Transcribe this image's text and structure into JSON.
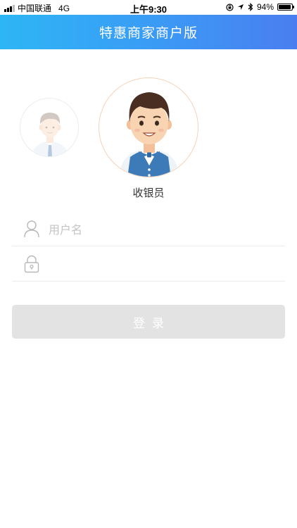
{
  "status_bar": {
    "carrier": "中国联通",
    "network": "4G",
    "time": "上午9:30",
    "battery": "94%",
    "battery_level": 0.94
  },
  "nav": {
    "title": "特惠商家商户版"
  },
  "roles": {
    "selected_label": "收银员",
    "selected_icon": "cashier-avatar-icon",
    "other_icon": "owner-avatar-icon"
  },
  "form": {
    "username": {
      "placeholder": "用户名",
      "value": "",
      "icon": "user-icon"
    },
    "password": {
      "placeholder": "",
      "value": "",
      "icon": "lock-icon"
    },
    "login_label": "登录"
  },
  "colors": {
    "nav_gradient_start": "#2db6f5",
    "nav_gradient_end": "#4a7ef0",
    "button_disabled": "#e3e3e3",
    "avatar_border": "#f6d2b8"
  }
}
